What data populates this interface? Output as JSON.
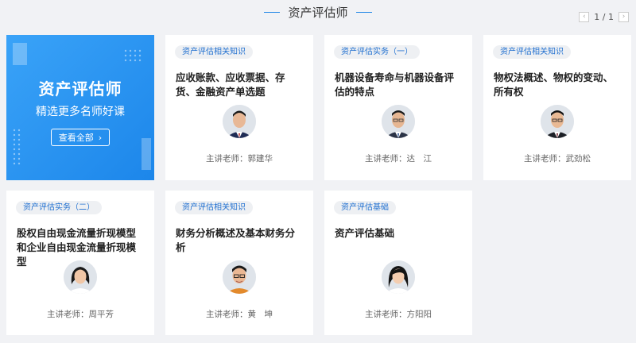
{
  "header": {
    "title": "资产评估师"
  },
  "pager": {
    "text": "1 / 1",
    "prev": "‹",
    "next": "›"
  },
  "promo": {
    "title": "资产评估师",
    "subtitle": "精选更多名师好课",
    "button_label": "查看全部",
    "button_icon": "›",
    "bg_color": "#2a93f1"
  },
  "courses": [
    {
      "tag": "资产评估相关知识",
      "title": "应收账款、应收票据、存货、金融资产单选题",
      "teacher": "主讲老师：郭建华"
    },
    {
      "tag": "资产评估实务（一）",
      "title": "机器设备寿命与机器设备评估的特点",
      "teacher": "主讲老师：达　江"
    },
    {
      "tag": "资产评估相关知识",
      "title": "物权法概述、物权的变动、所有权",
      "teacher": "主讲老师：武劲松"
    },
    {
      "tag": "资产评估实务（二）",
      "title": "股权自由现金流量折现模型和企业自由现金流量折现模型",
      "teacher": "主讲老师：周平芳"
    },
    {
      "tag": "资产评估相关知识",
      "title": "财务分析概述及基本财务分析",
      "teacher": "主讲老师：黄　坤"
    },
    {
      "tag": "资产评估基础",
      "title": "资产评估基础",
      "teacher": "主讲老师：方阳阳"
    }
  ]
}
